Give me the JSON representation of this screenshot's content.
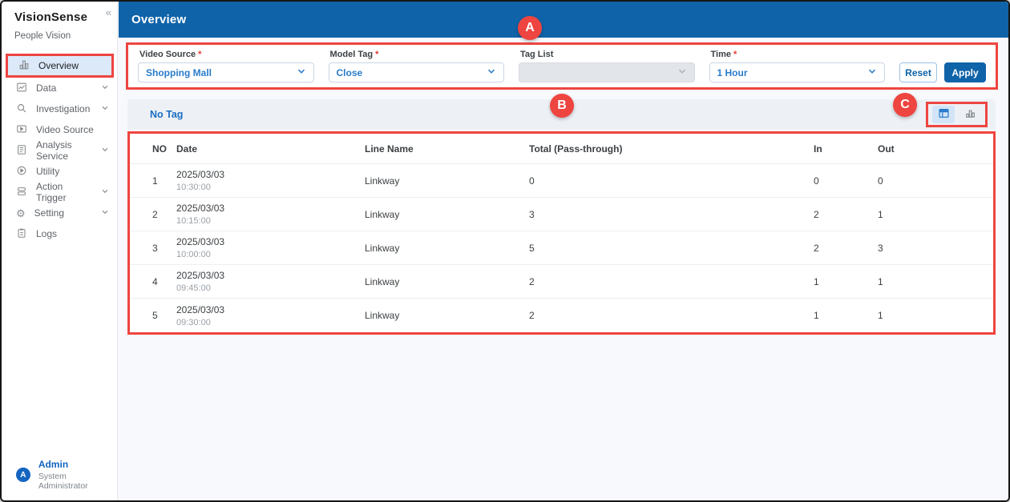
{
  "app": {
    "name": "VisionSense",
    "subtitle": "People Vision",
    "collapse_icon": "«"
  },
  "sidebar": {
    "items": [
      {
        "label": "Overview"
      },
      {
        "label": "Data"
      },
      {
        "label": "Investigation"
      },
      {
        "label": "Video Source"
      },
      {
        "label": "Analysis Service"
      },
      {
        "label": "Utility"
      },
      {
        "label": "Action Trigger"
      },
      {
        "label": "Setting"
      },
      {
        "label": "Logs"
      }
    ]
  },
  "user": {
    "avatar_initial": "A",
    "name": "Admin",
    "role": "System Administrator"
  },
  "header": {
    "title": "Overview"
  },
  "filters": {
    "video_source": {
      "label": "Video Source",
      "marker": "*",
      "value": "Shopping Mall"
    },
    "model_tag": {
      "label": "Model Tag",
      "marker": "*",
      "value": "Close"
    },
    "tag_list": {
      "label": "Tag List",
      "marker": "",
      "value": ""
    },
    "time": {
      "label": "Time",
      "marker": "*",
      "value": "1 Hour"
    },
    "reset_label": "Reset",
    "apply_label": "Apply"
  },
  "panel": {
    "tag_label": "No Tag"
  },
  "table": {
    "columns": {
      "no": "NO",
      "date": "Date",
      "line_name": "Line Name",
      "total": "Total (Pass-through)",
      "in": "In",
      "out": "Out"
    },
    "rows": [
      {
        "no": "1",
        "date": "2025/03/03",
        "time": "10:30:00",
        "line": "Linkway",
        "total": "0",
        "in": "0",
        "out": "0"
      },
      {
        "no": "2",
        "date": "2025/03/03",
        "time": "10:15:00",
        "line": "Linkway",
        "total": "3",
        "in": "2",
        "out": "1"
      },
      {
        "no": "3",
        "date": "2025/03/03",
        "time": "10:00:00",
        "line": "Linkway",
        "total": "5",
        "in": "2",
        "out": "3"
      },
      {
        "no": "4",
        "date": "2025/03/03",
        "time": "09:45:00",
        "line": "Linkway",
        "total": "2",
        "in": "1",
        "out": "1"
      },
      {
        "no": "5",
        "date": "2025/03/03",
        "time": "09:30:00",
        "line": "Linkway",
        "total": "2",
        "in": "1",
        "out": "1"
      }
    ]
  },
  "annotations": {
    "a": "A",
    "b": "B",
    "c": "C"
  },
  "colors": {
    "header_blue": "#0f63a8",
    "link_blue": "#2a7cc9",
    "annotation_red": "#ee4540"
  }
}
